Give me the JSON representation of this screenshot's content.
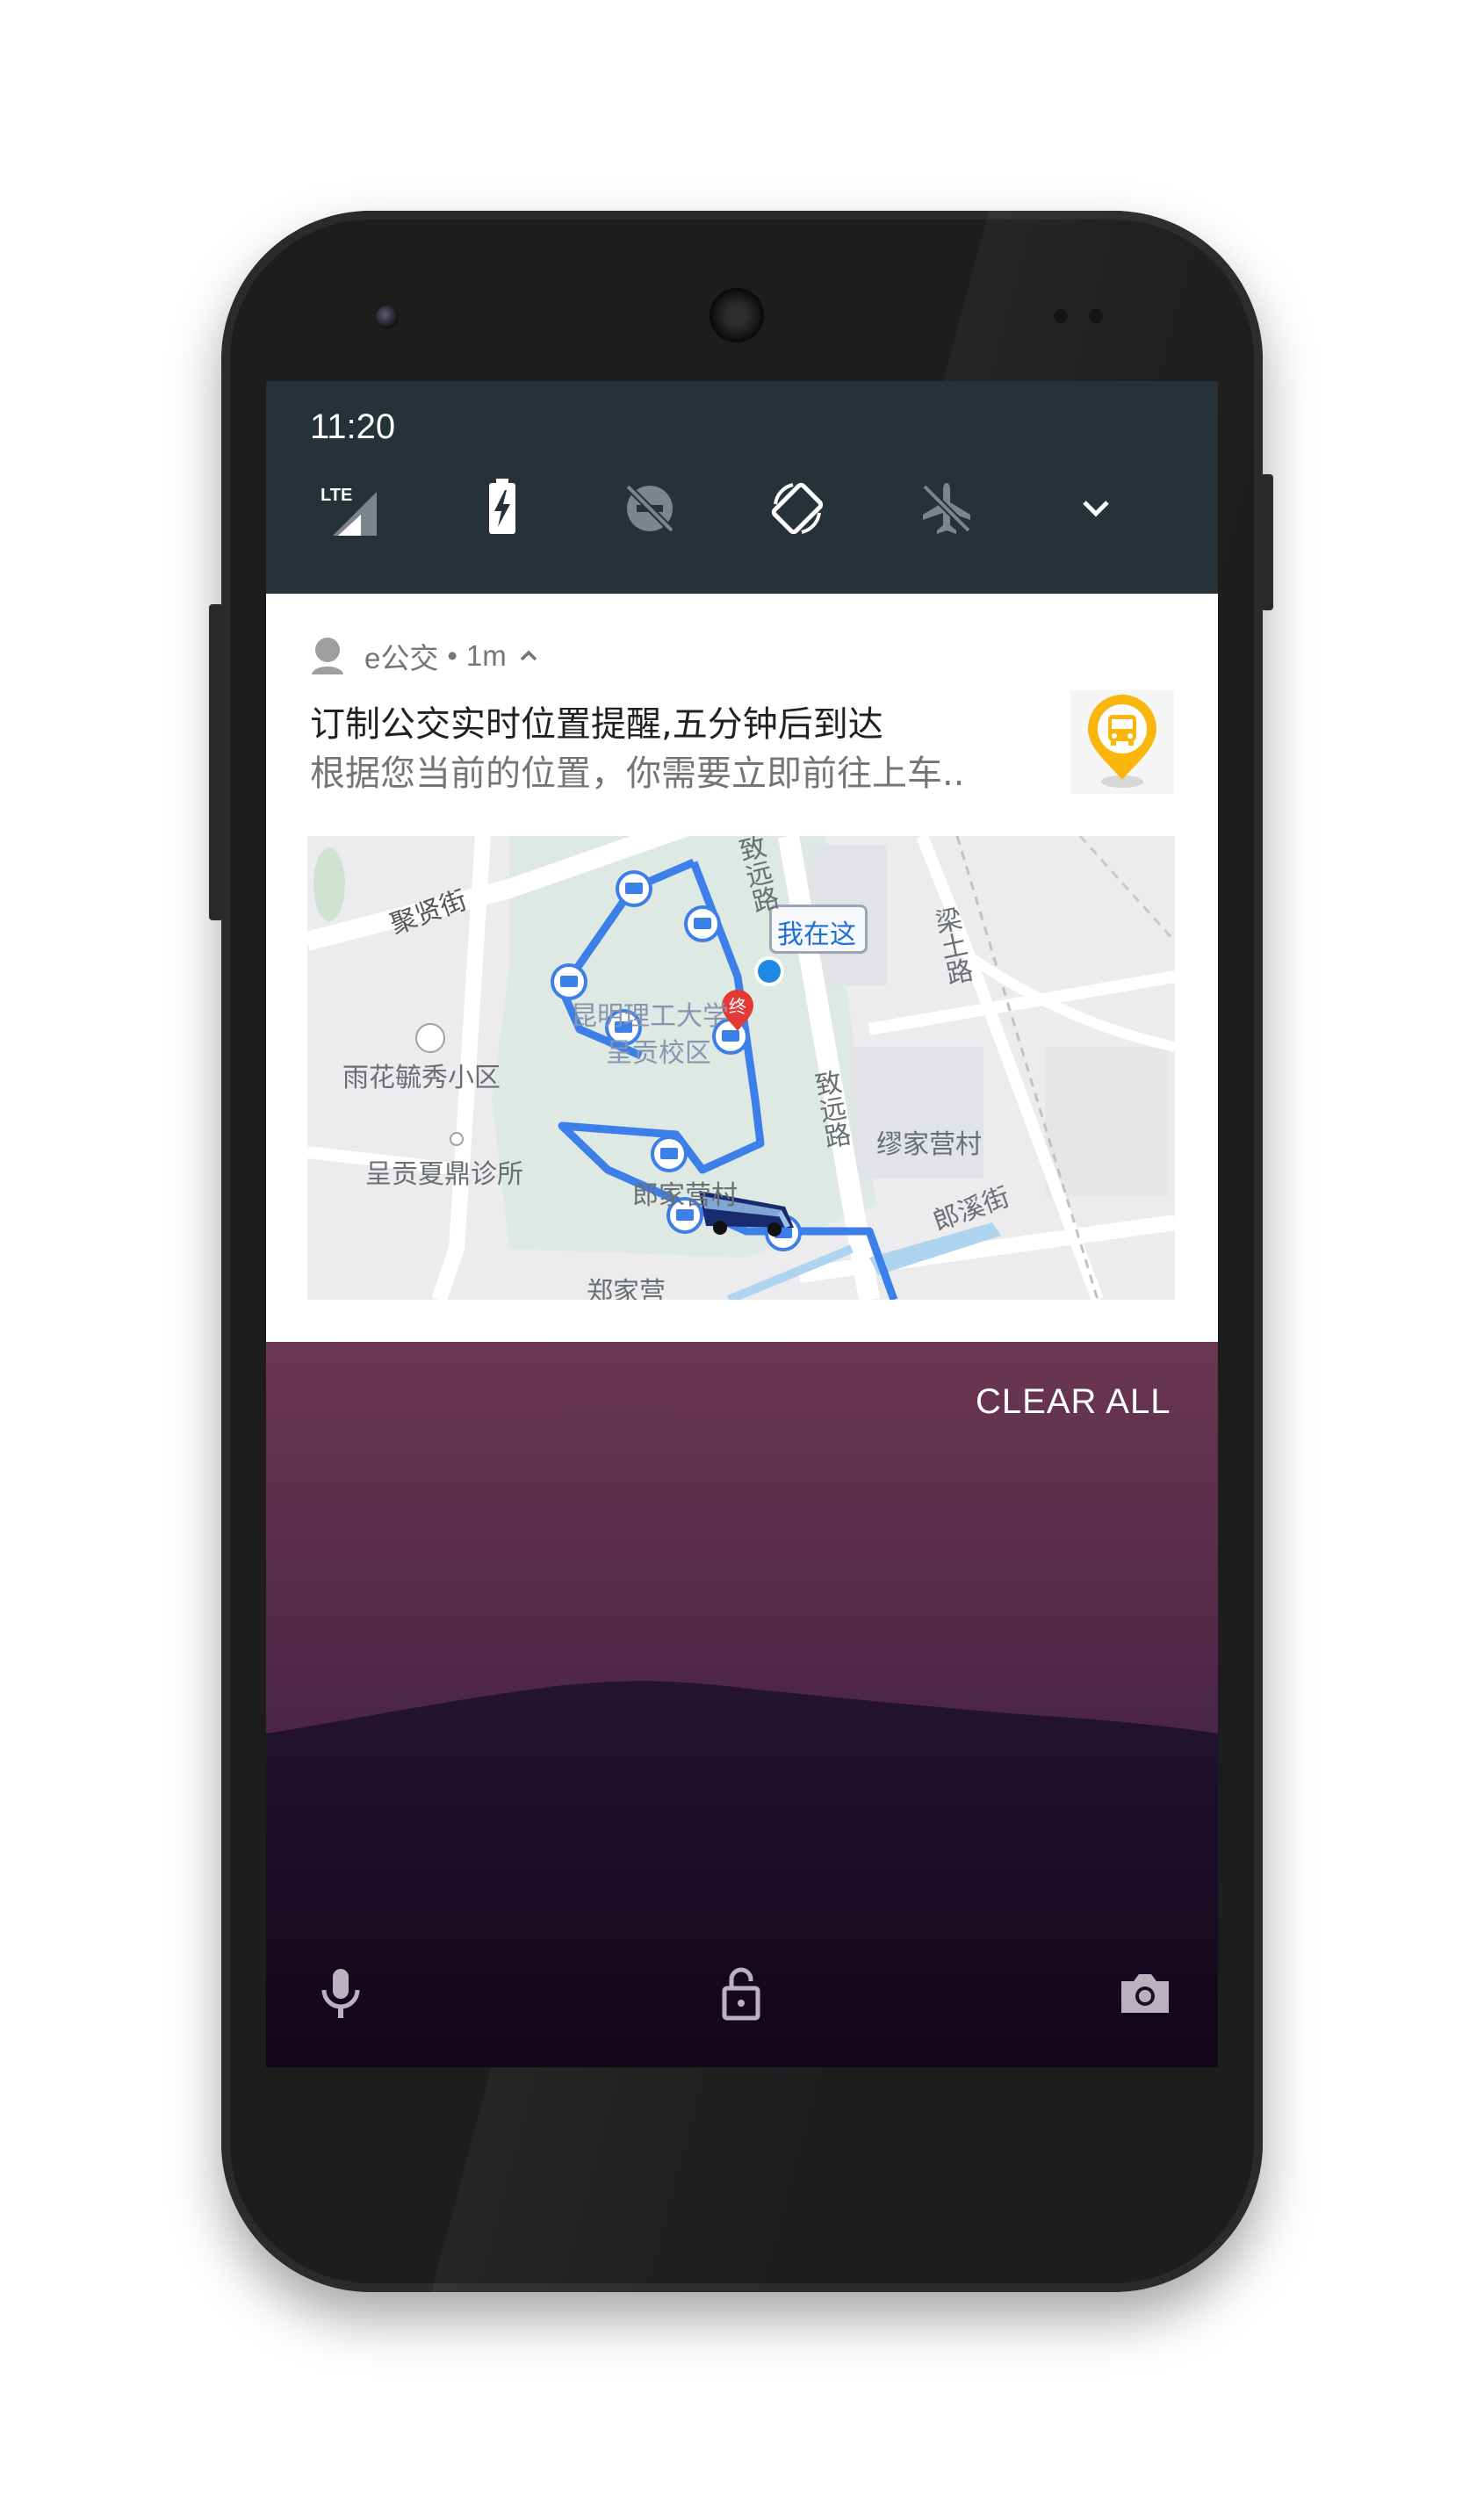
{
  "status_bar": {
    "time": "11:20"
  },
  "quick_settings": {
    "icons": [
      "lte-signal-icon",
      "battery-charging-icon",
      "do-not-disturb-off-icon",
      "auto-rotate-icon",
      "airplane-mode-off-icon",
      "expand-chevron-icon"
    ],
    "lte_label": "LTE"
  },
  "notification": {
    "app_name": "e公交",
    "time_ago": "1m",
    "separator": "•",
    "title": "订制公交实时位置提醒,五分钟后到达",
    "text": "根据您当前的位置，你需要立即前往上车..",
    "large_icon": "bus-stop-pin-icon",
    "map": {
      "labels": {
        "jux": "聚贤街",
        "yuhua": "雨花毓秀小区",
        "chenggong_clinic": "呈贡夏鼎诊所",
        "kmust": "昆明理工大学",
        "campus": "呈贡校区",
        "langjiaying": "郎家营村",
        "zhengjiaying": "郑家营",
        "zhiyuan1": "致远路",
        "zhiyuan2": "致远路",
        "liangtu": "梁土路",
        "miaojia": "缪家营村",
        "langxi": "郎溪街"
      },
      "you_are_here": "我在这",
      "end_marker": "终",
      "route_color": "#3d7fe8",
      "stop_count": 8
    }
  },
  "shade": {
    "clear_all": "CLEAR ALL"
  },
  "lockscreen": {
    "icons": [
      "microphone-icon",
      "unlock-icon",
      "camera-icon"
    ]
  },
  "colors": {
    "statusbar": "#263238",
    "accent_blue": "#1e88e5",
    "end_marker": "#e53935"
  }
}
